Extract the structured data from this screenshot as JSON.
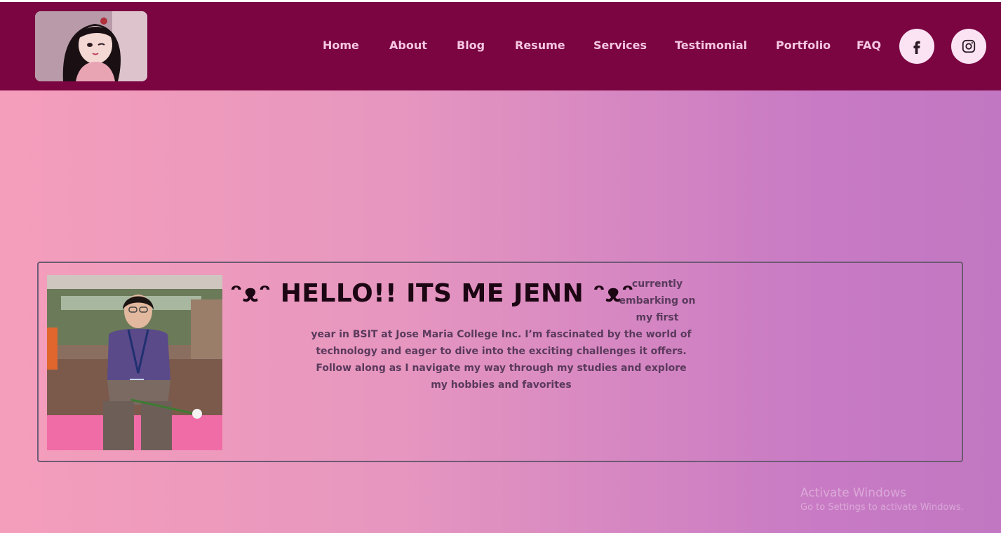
{
  "nav": {
    "items": [
      {
        "label": "Home"
      },
      {
        "label": "About"
      },
      {
        "label": "Blog"
      },
      {
        "label": "Resume"
      },
      {
        "label": "Services"
      },
      {
        "label": "Testimonial"
      },
      {
        "label": "Portfolio"
      },
      {
        "label": "FAQ"
      }
    ],
    "social": [
      {
        "icon": "facebook-icon"
      },
      {
        "icon": "instagram-icon"
      }
    ]
  },
  "hero": {
    "heading": "ᵔᴥᵔ HELLO!! ITS ME JENN ᵔᴥᵔ",
    "intro": "currently embarking on my first",
    "body": "year in BSIT at Jose Maria College Inc. I’m fascinated by the world of technology and eager to dive into the exciting challenges it offers. Follow along as I navigate my way through my studies and explore my hobbies and favorites"
  },
  "watermark": {
    "title": "Activate Windows",
    "subtitle": "Go to Settings to activate Windows."
  },
  "colors": {
    "navbar": "#7a0541",
    "nav_text": "#f6c6e2",
    "social_bg": "#fbe3f4",
    "gradient_start": "#f59ebb",
    "gradient_end": "#c277c2"
  }
}
